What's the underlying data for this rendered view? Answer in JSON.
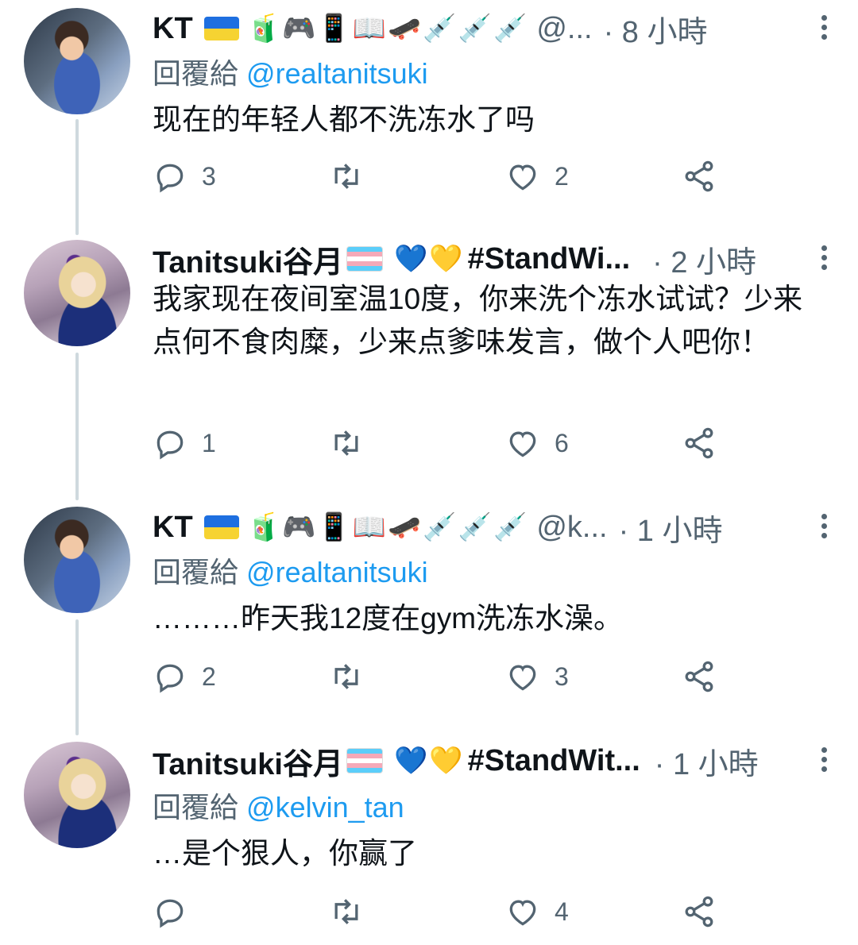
{
  "tweets": [
    {
      "name": "KT",
      "emojis": "🧃🎮📱📖🛹💉💉💉",
      "handle": "@...",
      "time": "· 8 小時",
      "reply_prefix": "回覆給",
      "reply_to": "@realtanitsuki",
      "text": "现在的年轻人都不洗冻水了吗",
      "replies": "3",
      "retweets": "",
      "likes": "2"
    },
    {
      "name": "Tanitsuki谷月",
      "emojis": "💙💛",
      "handle": "#StandWi...",
      "time": "· 2 小時",
      "text": "我家现在夜间室温10度，你来洗个冻水试试？少来点何不食肉糜，少来点爹味发言，做个人吧你！",
      "replies": "1",
      "retweets": "",
      "likes": "6"
    },
    {
      "name": "KT",
      "emojis": "🧃🎮📱📖🛹💉💉💉",
      "handle": "@k...",
      "time": "· 1 小時",
      "reply_prefix": "回覆給",
      "reply_to": "@realtanitsuki",
      "text": "………昨天我12度在gym洗冻水澡。",
      "replies": "2",
      "retweets": "",
      "likes": "3"
    },
    {
      "name": "Tanitsuki谷月",
      "emojis": "💙💛",
      "handle": "#StandWit...",
      "time": "· 1 小時",
      "reply_prefix": "回覆給",
      "reply_to": "@kelvin_tan",
      "text": "…是个狠人，你赢了",
      "replies": "",
      "retweets": "",
      "likes": "4"
    }
  ],
  "icons": {
    "reply": "reply-icon",
    "retweet": "retweet-icon",
    "like": "like-icon",
    "share": "share-icon",
    "more": "more-icon"
  },
  "colors": {
    "accent": "#1d9bf0",
    "muted": "#536471",
    "thread": "#cfd9de"
  }
}
